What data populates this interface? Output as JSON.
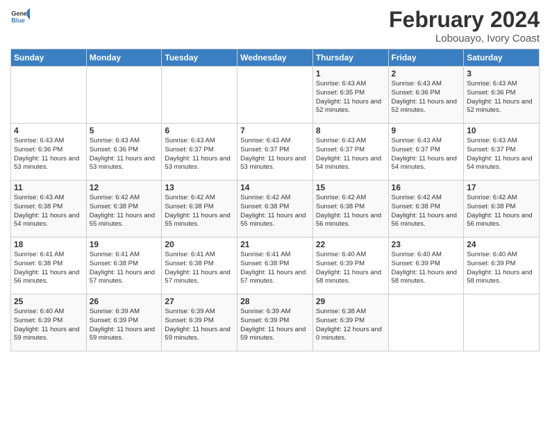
{
  "logo": {
    "text_general": "General",
    "text_blue": "Blue"
  },
  "header": {
    "title": "February 2024",
    "subtitle": "Lobouayo, Ivory Coast"
  },
  "days_of_week": [
    "Sunday",
    "Monday",
    "Tuesday",
    "Wednesday",
    "Thursday",
    "Friday",
    "Saturday"
  ],
  "weeks": [
    [
      {
        "day": "",
        "info": ""
      },
      {
        "day": "",
        "info": ""
      },
      {
        "day": "",
        "info": ""
      },
      {
        "day": "",
        "info": ""
      },
      {
        "day": "1",
        "info": "Sunrise: 6:43 AM\nSunset: 6:35 PM\nDaylight: 11 hours and 52 minutes."
      },
      {
        "day": "2",
        "info": "Sunrise: 6:43 AM\nSunset: 6:36 PM\nDaylight: 11 hours and 52 minutes."
      },
      {
        "day": "3",
        "info": "Sunrise: 6:43 AM\nSunset: 6:36 PM\nDaylight: 11 hours and 52 minutes."
      }
    ],
    [
      {
        "day": "4",
        "info": "Sunrise: 6:43 AM\nSunset: 6:36 PM\nDaylight: 11 hours and 53 minutes."
      },
      {
        "day": "5",
        "info": "Sunrise: 6:43 AM\nSunset: 6:36 PM\nDaylight: 11 hours and 53 minutes."
      },
      {
        "day": "6",
        "info": "Sunrise: 6:43 AM\nSunset: 6:37 PM\nDaylight: 11 hours and 53 minutes."
      },
      {
        "day": "7",
        "info": "Sunrise: 6:43 AM\nSunset: 6:37 PM\nDaylight: 11 hours and 53 minutes."
      },
      {
        "day": "8",
        "info": "Sunrise: 6:43 AM\nSunset: 6:37 PM\nDaylight: 11 hours and 54 minutes."
      },
      {
        "day": "9",
        "info": "Sunrise: 6:43 AM\nSunset: 6:37 PM\nDaylight: 11 hours and 54 minutes."
      },
      {
        "day": "10",
        "info": "Sunrise: 6:43 AM\nSunset: 6:37 PM\nDaylight: 11 hours and 54 minutes."
      }
    ],
    [
      {
        "day": "11",
        "info": "Sunrise: 6:43 AM\nSunset: 6:38 PM\nDaylight: 11 hours and 54 minutes."
      },
      {
        "day": "12",
        "info": "Sunrise: 6:42 AM\nSunset: 6:38 PM\nDaylight: 11 hours and 55 minutes."
      },
      {
        "day": "13",
        "info": "Sunrise: 6:42 AM\nSunset: 6:38 PM\nDaylight: 11 hours and 55 minutes."
      },
      {
        "day": "14",
        "info": "Sunrise: 6:42 AM\nSunset: 6:38 PM\nDaylight: 11 hours and 55 minutes."
      },
      {
        "day": "15",
        "info": "Sunrise: 6:42 AM\nSunset: 6:38 PM\nDaylight: 11 hours and 56 minutes."
      },
      {
        "day": "16",
        "info": "Sunrise: 6:42 AM\nSunset: 6:38 PM\nDaylight: 11 hours and 56 minutes."
      },
      {
        "day": "17",
        "info": "Sunrise: 6:42 AM\nSunset: 6:38 PM\nDaylight: 11 hours and 56 minutes."
      }
    ],
    [
      {
        "day": "18",
        "info": "Sunrise: 6:41 AM\nSunset: 6:38 PM\nDaylight: 11 hours and 56 minutes."
      },
      {
        "day": "19",
        "info": "Sunrise: 6:41 AM\nSunset: 6:38 PM\nDaylight: 11 hours and 57 minutes."
      },
      {
        "day": "20",
        "info": "Sunrise: 6:41 AM\nSunset: 6:38 PM\nDaylight: 11 hours and 57 minutes."
      },
      {
        "day": "21",
        "info": "Sunrise: 6:41 AM\nSunset: 6:38 PM\nDaylight: 11 hours and 57 minutes."
      },
      {
        "day": "22",
        "info": "Sunrise: 6:40 AM\nSunset: 6:39 PM\nDaylight: 11 hours and 58 minutes."
      },
      {
        "day": "23",
        "info": "Sunrise: 6:40 AM\nSunset: 6:39 PM\nDaylight: 11 hours and 58 minutes."
      },
      {
        "day": "24",
        "info": "Sunrise: 6:40 AM\nSunset: 6:39 PM\nDaylight: 11 hours and 58 minutes."
      }
    ],
    [
      {
        "day": "25",
        "info": "Sunrise: 6:40 AM\nSunset: 6:39 PM\nDaylight: 11 hours and 59 minutes."
      },
      {
        "day": "26",
        "info": "Sunrise: 6:39 AM\nSunset: 6:39 PM\nDaylight: 11 hours and 59 minutes."
      },
      {
        "day": "27",
        "info": "Sunrise: 6:39 AM\nSunset: 6:39 PM\nDaylight: 11 hours and 59 minutes."
      },
      {
        "day": "28",
        "info": "Sunrise: 6:39 AM\nSunset: 6:39 PM\nDaylight: 11 hours and 59 minutes."
      },
      {
        "day": "29",
        "info": "Sunrise: 6:38 AM\nSunset: 6:39 PM\nDaylight: 12 hours and 0 minutes."
      },
      {
        "day": "",
        "info": ""
      },
      {
        "day": "",
        "info": ""
      }
    ]
  ]
}
